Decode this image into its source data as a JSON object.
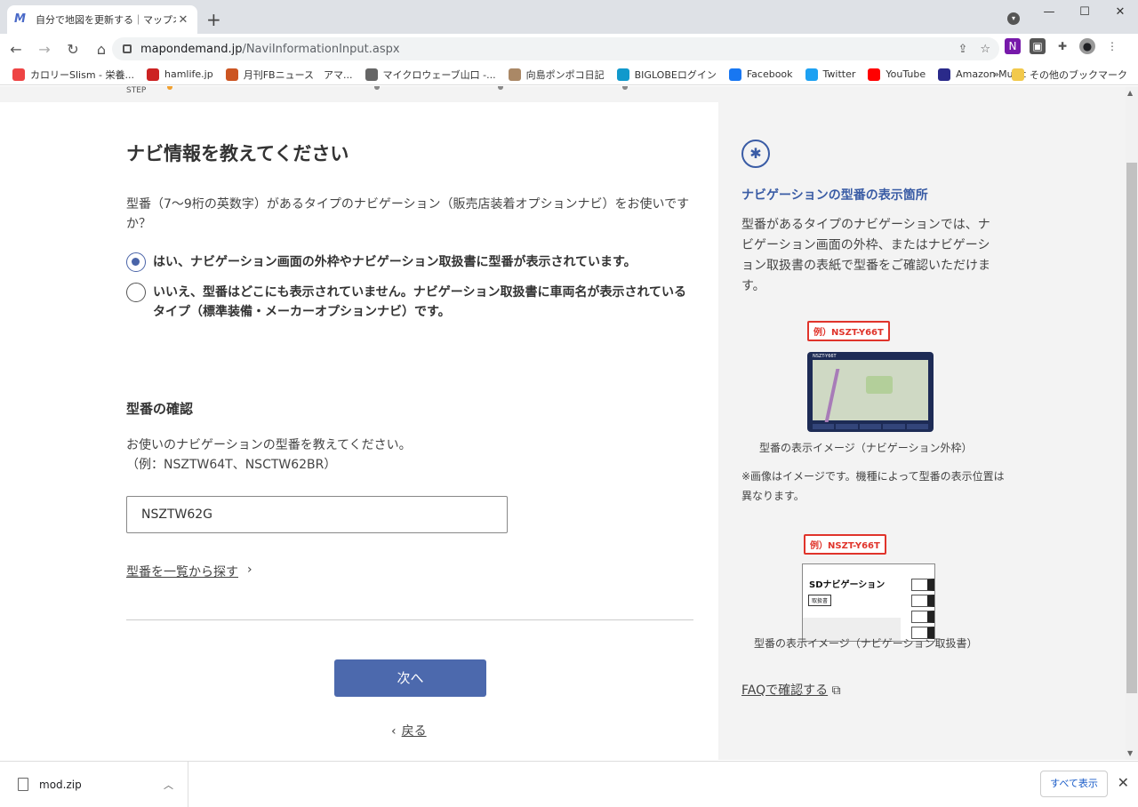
{
  "browser": {
    "tab_title": "自分で地図を更新する｜マップオンデ",
    "tab_close": "✕",
    "new_tab": "+",
    "url_host": "mapondemand.jp",
    "url_path": "/NaviInformationInput.aspx",
    "bookmarks": [
      {
        "label": "カロリーSlism - 栄養...",
        "color": "#e44"
      },
      {
        "label": "hamlife.jp",
        "color": "#c22"
      },
      {
        "label": "月刊FBニュース　アマ...",
        "color": "#c52"
      },
      {
        "label": "マイクロウェーブ山口 -...",
        "color": "#666"
      },
      {
        "label": "向島ポンポコ日記",
        "color": "#a86"
      },
      {
        "label": "BIGLOBEログイン",
        "color": "#19c"
      },
      {
        "label": "Facebook",
        "color": "#1877f2"
      },
      {
        "label": "Twitter",
        "color": "#1da1f2"
      },
      {
        "label": "YouTube",
        "color": "#f00"
      },
      {
        "label": "Amazon Music",
        "color": "#2a2a8a"
      }
    ],
    "bookmarks_more": "»",
    "other_bookmarks": "その他のブックマーク"
  },
  "page": {
    "step_label": "STEP",
    "heading": "ナビ情報を教えてください",
    "question": "型番（7〜9桁の英数字）があるタイプのナビゲーション（販売店装着オプションナビ）をお使いですか？",
    "option_yes": "はい、ナビゲーション画面の外枠やナビゲーション取扱書に型番が表示されています。",
    "option_no": "いいえ、型番はどこにも表示されていません。ナビゲーション取扱書に車両名が表示されているタイプ（標準装備・メーカーオプションナビ）です。",
    "model_heading": "型番の確認",
    "model_desc_1": "お使いのナビゲーションの型番を教えてください。",
    "model_desc_2": "（例：NSZTW64T、NSCTW62BR）",
    "model_value": "NSZTW62G",
    "list_link": "型番を一覧から探す",
    "next_button": "次へ",
    "back_link": "戻る"
  },
  "side": {
    "heading": "ナビゲーションの型番の表示箇所",
    "text": "型番があるタイプのナビゲーションでは、ナビゲーション画面の外枠、またはナビゲーション取扱書の表紙で型番をご確認いただけます。",
    "example_tag": "例）NSZT-Y66T",
    "navi_small_label": "NSZT-Y66T",
    "caption_frame": "型番の表示イメージ（ナビゲーション外枠）",
    "note": "※画像はイメージです。機種によって型番の表示位置は異なります。",
    "manual_title": "SDナビゲーション",
    "manual_badge": "取扱書",
    "caption_manual": "型番の表示イメージ（ナビゲーション取扱書）",
    "faq_link": "FAQで確認する"
  },
  "download": {
    "file": "mod.zip",
    "show_all": "すべて表示"
  },
  "colors": {
    "accent": "#4c69ad",
    "side_heading": "#3a5ca5",
    "tag_red": "#e0342b"
  }
}
